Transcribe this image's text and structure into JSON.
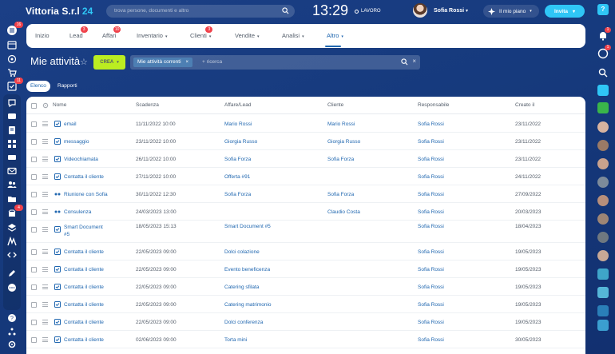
{
  "header": {
    "brand": "Vittoria S.r.l",
    "brand_number": "24",
    "search_placeholder": "trova persone, documenti e altro",
    "clock": "13:29",
    "work_status": "LAVORO",
    "user_name": "Sofia Rossi",
    "plan_label": "Il mio piano",
    "invite_label": "Invita",
    "help_label": "?"
  },
  "left_sidebar": {
    "menu_badge": "16",
    "tasks_badge": "11",
    "drive_badge": "4"
  },
  "right_sidebar": {
    "notif_badge": "1",
    "chat_badge": "1"
  },
  "nav": {
    "tabs": [
      {
        "label": "Inizio",
        "count": "",
        "caret": false
      },
      {
        "label": "Lead",
        "count": "3",
        "caret": false
      },
      {
        "label": "Affari",
        "count": "10",
        "caret": false
      },
      {
        "label": "Inventario",
        "count": "",
        "caret": true
      },
      {
        "label": "Clienti",
        "count": "3",
        "caret": true
      },
      {
        "label": "Vendite",
        "count": "",
        "caret": true
      },
      {
        "label": "Analisi",
        "count": "",
        "caret": true
      },
      {
        "label": "Altro",
        "count": "",
        "caret": true
      }
    ],
    "active": "Altro"
  },
  "page": {
    "title": "Mie attività",
    "create_label": "CREA",
    "filter_chip": "Mie attività correnti",
    "filter_placeholder": "+ ricerca"
  },
  "views": {
    "list_label": "Elenco",
    "reports_label": "Rapporti",
    "selected": "Elenco"
  },
  "table": {
    "headers": [
      "Nome",
      "Scadenza",
      "Affare/Lead",
      "Cliente",
      "Responsabile",
      "Creato il"
    ],
    "rows": [
      {
        "icon": "task",
        "name": "email",
        "name2": "",
        "deadline": "11/11/2022 10:00",
        "deal": "Mario Rossi",
        "client": "Mario Rossi",
        "owner": "Sofia Rossi",
        "created": "23/11/2022"
      },
      {
        "icon": "task",
        "name": "messaggio",
        "name2": "",
        "deadline": "23/11/2022 10:00",
        "deal": "Giorgia Russo",
        "client": "Giorgia Russo",
        "owner": "Sofia Rossi",
        "created": "23/11/2022"
      },
      {
        "icon": "task",
        "name": "Videochiamata",
        "name2": "",
        "deadline": "26/11/2022 10:00",
        "deal": "Sofia Forza",
        "client": "Sofia Forza",
        "owner": "Sofia Rossi",
        "created": "23/11/2022"
      },
      {
        "icon": "task",
        "name": "Contatta il cliente",
        "name2": "",
        "deadline": "27/11/2022 10:00",
        "deal": "Offerta #91",
        "client": "",
        "owner": "Sofia Rossi",
        "created": "24/11/2022"
      },
      {
        "icon": "meeting",
        "name": "Riunione con Sofia",
        "name2": "",
        "deadline": "30/11/2022 12:30",
        "deal": "Sofia Forza",
        "client": "Sofia Forza",
        "owner": "Sofia Rossi",
        "created": "27/09/2022"
      },
      {
        "icon": "meeting",
        "name": "Consulenza",
        "name2": "",
        "deadline": "24/03/2023 13:00",
        "deal": "",
        "client": "Claudio Costa",
        "owner": "Sofia Rossi",
        "created": "20/03/2023"
      },
      {
        "icon": "task",
        "name": "Smart Document",
        "name2": "#5",
        "deadline": "18/05/2023 15:13",
        "deal": "Smart Document #5",
        "client": "",
        "owner": "Sofia Rossi",
        "created": "18/04/2023"
      },
      {
        "icon": "task",
        "name": "Contatta il cliente",
        "name2": "",
        "deadline": "22/05/2023 09:00",
        "deal": "Dolci colazione",
        "client": "",
        "owner": "Sofia Rossi",
        "created": "19/05/2023"
      },
      {
        "icon": "task",
        "name": "Contatta il cliente",
        "name2": "",
        "deadline": "22/05/2023 09:00",
        "deal": "Evento beneficenza",
        "client": "",
        "owner": "Sofia Rossi",
        "created": "19/05/2023"
      },
      {
        "icon": "task",
        "name": "Contatta il cliente",
        "name2": "",
        "deadline": "22/05/2023 09:00",
        "deal": "Catering sfilata",
        "client": "",
        "owner": "Sofia Rossi",
        "created": "19/05/2023"
      },
      {
        "icon": "task",
        "name": "Contatta il cliente",
        "name2": "",
        "deadline": "22/05/2023 09:00",
        "deal": "Catering matrimonio",
        "client": "",
        "owner": "Sofia Rossi",
        "created": "19/05/2023"
      },
      {
        "icon": "task",
        "name": "Contatta il cliente",
        "name2": "",
        "deadline": "22/05/2023 09:00",
        "deal": "Dolci conferenza",
        "client": "",
        "owner": "Sofia Rossi",
        "created": "19/05/2023"
      },
      {
        "icon": "task",
        "name": "Contatta il cliente",
        "name2": "",
        "deadline": "02/06/2023 09:00",
        "deal": "Torta mini",
        "client": "",
        "owner": "Sofia Rossi",
        "created": "30/05/2023"
      }
    ]
  },
  "colors": {
    "accent": "#2fc6f6",
    "link": "#2067b0",
    "create": "#bbed21",
    "badge": "#f0424b",
    "background": "#1b3f86"
  }
}
